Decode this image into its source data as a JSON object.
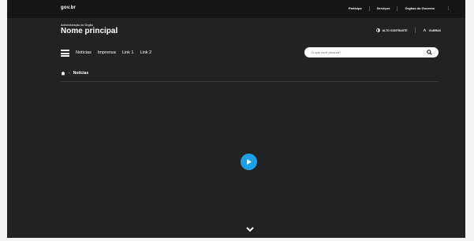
{
  "govbar": {
    "logo": "gov.br",
    "links": [
      "Participe",
      "Serviços",
      "Órgãos do Governo"
    ],
    "more_label": "⋮"
  },
  "header": {
    "org_small": "Administração do Órgão",
    "org_name": "Nome principal",
    "tools": [
      {
        "label": "ALTO CONTRASTE",
        "icon": "contrast-icon"
      },
      {
        "label": "VLIBRAS",
        "icon": "accessibility-icon"
      }
    ]
  },
  "nav": {
    "menu_icon": "hamburger-menu-icon",
    "items": [
      "Notícias",
      "Imprensa",
      "Link 1",
      "Link 2"
    ]
  },
  "search": {
    "placeholder": "O que você procura?",
    "icon": "search-icon"
  },
  "breadcrumb": {
    "home_icon": "home-icon",
    "current": "Notícias"
  },
  "video": {
    "play_icon": "play-icon"
  },
  "footer": {
    "scroll_icon": "chevron-down-icon"
  },
  "colors": {
    "govbar_bg": "#151515",
    "main_bg": "#222222",
    "accent": "#1ea0e7",
    "text": "#ffffff"
  }
}
